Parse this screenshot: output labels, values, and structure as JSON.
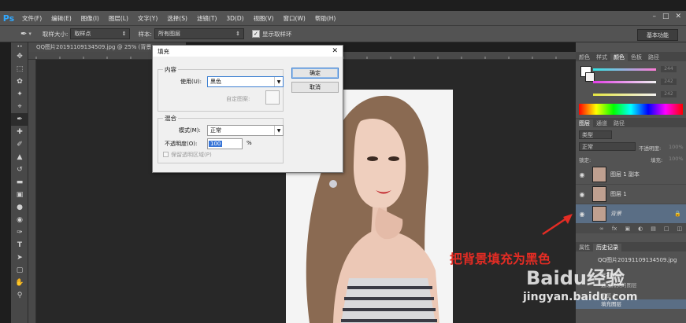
{
  "menubar": {
    "logo": "Ps",
    "items": [
      "文件(F)",
      "编辑(E)",
      "图像(I)",
      "图层(L)",
      "文字(Y)",
      "选择(S)",
      "滤镜(T)",
      "3D(D)",
      "视图(V)",
      "窗口(W)",
      "帮助(H)"
    ]
  },
  "options": {
    "sample_size_label": "取样大小:",
    "sample_size_value": "取样点",
    "sample_label": "样本:",
    "sample_value": "所有图层",
    "show_ring_label": "显示取样环",
    "workspace": "基本功能"
  },
  "document": {
    "tab_title": "QQ图片20191109134509.jpg @ 25% (背景"
  },
  "dialog": {
    "title": "填充",
    "contents_group": "内容",
    "use_label": "使用(U):",
    "use_value": "黑色",
    "custom_pattern_label": "自定图案:",
    "blending_group": "混合",
    "mode_label": "模式(M):",
    "mode_value": "正常",
    "opacity_label": "不透明度(O):",
    "opacity_value": "100",
    "opacity_unit": "%",
    "preserve_label": "保留透明区域(P)",
    "ok_button": "确定",
    "cancel_button": "取消"
  },
  "annotation": {
    "text": "把背景填充为黑色",
    "color": "#e32c24"
  },
  "panels": {
    "top_tabs": [
      "颜色",
      "样式",
      "颜色",
      "色板",
      "路径"
    ],
    "color_values": [
      "244",
      "242",
      "242"
    ],
    "layers_tabs": [
      "图层",
      "通道",
      "路径"
    ],
    "kind_label": "类型",
    "blend_mode": "正常",
    "opacity_label": "不透明度:",
    "opacity_value": "100%",
    "lock_label": "锁定:",
    "fill_label": "填充:",
    "fill_value": "100%",
    "layers": [
      "图层 1 副本",
      "图层 1",
      "背景"
    ],
    "history_tabs": [
      "属性",
      "历史记录"
    ],
    "history_items": [
      "QQ图片20191109134509.jpg",
      "复制图层",
      "通过拷贝的图层",
      "图层 1",
      "填充图层"
    ]
  },
  "watermark": {
    "brand": "Baidu经验",
    "url": "jingyan.baidu.com"
  }
}
